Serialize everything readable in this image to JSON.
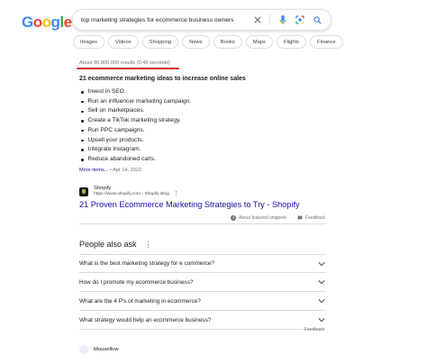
{
  "logo": {
    "letters": [
      "G",
      "o",
      "o",
      "g",
      "l",
      "e"
    ]
  },
  "search": {
    "query": "top marketing strategies for ecommerce business owners"
  },
  "chips": [
    "Images",
    "Videos",
    "Shopping",
    "News",
    "Books",
    "Maps",
    "Flights",
    "Finance"
  ],
  "stats": "About 86,800,000 results (0.49 seconds)",
  "snippet": {
    "title": "21 ecommerce marketing ideas to increase online sales",
    "items": [
      "Invest in SEO.",
      "Run an influencer marketing campaign.",
      "Sell on marketplaces.",
      "Create a TikTok marketing strategy.",
      "Run PPC campaigns.",
      "Upsell your products.",
      "Integrate Instagram.",
      "Reduce abandoned carts."
    ],
    "more": "More items...",
    "date": " • Apr 14, 2022"
  },
  "result": {
    "site": "Shopify",
    "url": "https://www.shopify.com › Shopify Blog",
    "title": "21 Proven Ecommerce Marketing Strategies to Try - Shopify"
  },
  "about_snippets": "About featured snippets",
  "feedback": "Feedback",
  "paa": {
    "title": "People also ask",
    "questions": [
      "What is the best marketing strategy for e commerce?",
      "How do I promote my ecommerce business?",
      "What are the 4 P's of marketing in ecommerce?",
      "What strategy would help an ecommerce business?"
    ]
  },
  "next_result": {
    "site": "Mouseflow"
  },
  "colors": {
    "link": "#1a0dab",
    "highlight": "#d32f2f"
  }
}
